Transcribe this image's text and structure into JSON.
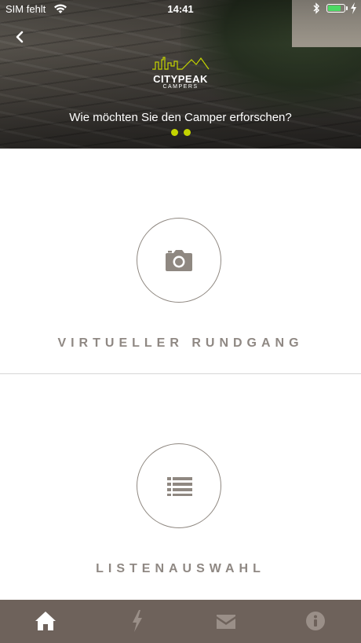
{
  "status_bar": {
    "carrier": "SIM fehlt",
    "time": "14:41",
    "battery_level": 0.85,
    "battery_color": "#4cd964"
  },
  "header": {
    "back_icon": "chevron-left-icon",
    "logo": {
      "name": "CITYPEAK",
      "subtitle": "CAMPERS",
      "accent_color": "#c4d400"
    },
    "question": "Wie möchten Sie den Camper erforschen?",
    "pager": {
      "pages": 2,
      "active_index": 0,
      "dot_color": "#c4d400"
    }
  },
  "options": [
    {
      "label": "VIRTUELLER RUNDGANG",
      "icon": "camera-icon"
    },
    {
      "label": "LISTENAUSWAHL",
      "icon": "list-icon"
    }
  ],
  "tab_bar": {
    "background": "#6e625b",
    "active_color": "#ffffff",
    "inactive_color": "#9a8f88",
    "tabs": [
      {
        "icon": "home-icon",
        "active": true
      },
      {
        "icon": "lightning-icon",
        "active": false
      },
      {
        "icon": "envelope-icon",
        "active": false
      },
      {
        "icon": "info-icon",
        "active": false
      }
    ]
  }
}
